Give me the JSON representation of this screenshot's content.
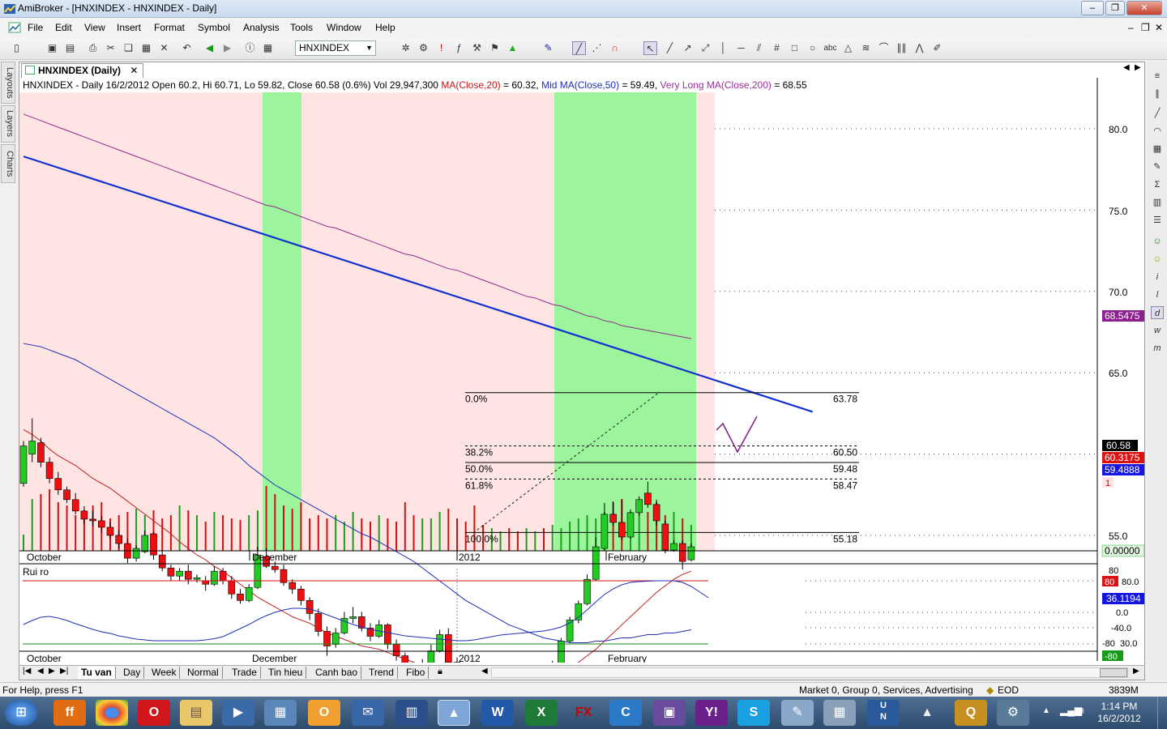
{
  "window": {
    "title": "AmiBroker - [HNXINDEX - HNXINDEX - Daily]",
    "doc_minimize": "–",
    "doc_restore": "❐",
    "doc_close": "✕"
  },
  "menu": [
    "File",
    "Edit",
    "View",
    "Insert",
    "Format",
    "Symbol",
    "Analysis",
    "Tools",
    "Window",
    "Help"
  ],
  "toolbar": {
    "symbol": "HNXINDEX"
  },
  "side_tabs": [
    "Layouts",
    "Layers",
    "Charts"
  ],
  "doc_tab": {
    "label": "HNXINDEX (Daily)",
    "close": "✕"
  },
  "header": {
    "prefix": "HNXINDEX - Daily 16/2/2012 Open 60.2, Hi 60.71, Lo 59.82, Close 60.58 (0.6%) Vol 29,947,300",
    "ma20_label": "MA(Close,20)",
    "ma20_value": " = 60.32,",
    "ma50_label": "Mid MA(Close,50)",
    "ma50_value": " = 59.49,",
    "ma200_label": "Very Long MA(Close,200)",
    "ma200_value": " = 68.55"
  },
  "axis": {
    "price_ticks": [
      "80.0",
      "75.0",
      "70.0",
      "65.0",
      "55.0"
    ],
    "price_tags": {
      "ma200": "68.5475",
      "close": "60.58",
      "ma20": "60.3175",
      "ma50": "59.4888",
      "one": "1",
      "zero": "0.00000"
    },
    "date_labels": [
      "October",
      "December",
      "2012",
      "February"
    ]
  },
  "fibo": {
    "levels": [
      {
        "pct": "0.0%",
        "value": "63.78"
      },
      {
        "pct": "38.2%",
        "value": "60.50"
      },
      {
        "pct": "50.0%",
        "value": "59.48"
      },
      {
        "pct": "61.8%",
        "value": "58.47"
      },
      {
        "pct": "100.0%",
        "value": "55.18"
      }
    ]
  },
  "indicator": {
    "name": "Rui ro",
    "tags": {
      "top": "80",
      "red": "80",
      "blue": "36.1194",
      "green": "-80"
    },
    "ticks": [
      "80.0",
      "0.0",
      "-40.0",
      "30.0"
    ],
    "ticks2": [
      "-80"
    ],
    "date_labels": [
      "October",
      "December",
      "2012",
      "February"
    ]
  },
  "sheet_tabs": [
    "Tu van",
    "Day",
    "Week",
    "Normal",
    "Trade",
    "Tin hieu",
    "Canh bao",
    "Trend",
    "Fibo"
  ],
  "status": {
    "help": "For Help, press F1",
    "market": "Market 0, Group 0, Services, Advertising",
    "mode": "EOD",
    "memory": "3839M"
  },
  "taskbar": {
    "time": "1:14 PM",
    "date": "16/2/2012"
  },
  "chart_data": {
    "type": "candlestick",
    "period": "Daily",
    "symbol": "HNXINDEX",
    "ylim": [
      54,
      83
    ],
    "candles": [
      {
        "o": 58.2,
        "c": 60.5,
        "h": 60.8,
        "l": 58.0
      },
      {
        "o": 60.0,
        "c": 60.8,
        "h": 62.2,
        "l": 59.5
      },
      {
        "o": 60.7,
        "c": 59.5,
        "h": 61.0,
        "l": 59.2
      },
      {
        "o": 59.5,
        "c": 58.5,
        "h": 59.8,
        "l": 58.2
      },
      {
        "o": 58.5,
        "c": 57.8,
        "h": 58.9,
        "l": 57.5
      },
      {
        "o": 57.8,
        "c": 57.2,
        "h": 58.0,
        "l": 57.0
      },
      {
        "o": 57.2,
        "c": 56.5,
        "h": 57.6,
        "l": 56.3
      },
      {
        "o": 56.5,
        "c": 56.0,
        "h": 56.8,
        "l": 55.7
      },
      {
        "o": 56.0,
        "c": 55.9,
        "h": 56.5,
        "l": 55.6
      },
      {
        "o": 55.9,
        "c": 55.5,
        "h": 56.2,
        "l": 55.2
      },
      {
        "o": 55.5,
        "c": 55.0,
        "h": 55.8,
        "l": 54.8
      },
      {
        "o": 55.0,
        "c": 54.5,
        "h": 55.3,
        "l": 54.2
      },
      {
        "o": 54.5,
        "c": 53.6,
        "h": 54.8,
        "l": 53.3
      },
      {
        "o": 53.6,
        "c": 54.2,
        "h": 54.4,
        "l": 53.4
      },
      {
        "o": 54.0,
        "c": 55.0,
        "h": 55.3,
        "l": 53.9
      },
      {
        "o": 55.1,
        "c": 53.8,
        "h": 55.2,
        "l": 53.5
      },
      {
        "o": 53.8,
        "c": 53.0,
        "h": 54.1,
        "l": 52.8
      },
      {
        "o": 53.0,
        "c": 52.5,
        "h": 53.2,
        "l": 52.2
      },
      {
        "o": 52.5,
        "c": 52.8,
        "h": 53.0,
        "l": 52.2
      },
      {
        "o": 52.8,
        "c": 52.3,
        "h": 53.2,
        "l": 52.0
      },
      {
        "o": 52.3,
        "c": 52.4,
        "h": 52.6,
        "l": 52.1
      },
      {
        "o": 52.2,
        "c": 52.0,
        "h": 52.5,
        "l": 51.6
      },
      {
        "o": 52.0,
        "c": 52.8,
        "h": 53.1,
        "l": 51.9
      },
      {
        "o": 52.8,
        "c": 52.2,
        "h": 53.0,
        "l": 52.0
      },
      {
        "o": 52.2,
        "c": 51.4,
        "h": 52.5,
        "l": 51.1
      },
      {
        "o": 51.4,
        "c": 51.0,
        "h": 51.7,
        "l": 50.8
      },
      {
        "o": 51.0,
        "c": 51.8,
        "h": 52.0,
        "l": 50.9
      },
      {
        "o": 51.8,
        "c": 53.8,
        "h": 54.3,
        "l": 51.7
      },
      {
        "o": 53.7,
        "c": 53.1,
        "h": 54.2,
        "l": 53.0
      },
      {
        "o": 53.1,
        "c": 52.9,
        "h": 53.4,
        "l": 52.7
      },
      {
        "o": 52.9,
        "c": 52.1,
        "h": 53.2,
        "l": 51.9
      },
      {
        "o": 52.1,
        "c": 51.7,
        "h": 52.3,
        "l": 51.4
      },
      {
        "o": 51.7,
        "c": 51.0,
        "h": 51.9,
        "l": 50.7
      },
      {
        "o": 51.0,
        "c": 50.2,
        "h": 51.2,
        "l": 49.8
      },
      {
        "o": 50.2,
        "c": 49.1,
        "h": 50.5,
        "l": 48.8
      },
      {
        "o": 49.1,
        "c": 48.2,
        "h": 49.4,
        "l": 47.6
      },
      {
        "o": 48.3,
        "c": 49.0,
        "h": 49.3,
        "l": 48.1
      },
      {
        "o": 49.0,
        "c": 49.9,
        "h": 50.3,
        "l": 48.9
      },
      {
        "o": 49.9,
        "c": 50.0,
        "h": 50.6,
        "l": 49.6
      },
      {
        "o": 50.0,
        "c": 49.3,
        "h": 50.3,
        "l": 49.1
      },
      {
        "o": 49.3,
        "c": 48.8,
        "h": 49.6,
        "l": 48.5
      },
      {
        "o": 48.8,
        "c": 49.5,
        "h": 49.8,
        "l": 48.7
      },
      {
        "o": 49.5,
        "c": 48.3,
        "h": 49.6,
        "l": 48.0
      },
      {
        "o": 48.3,
        "c": 47.6,
        "h": 48.6,
        "l": 47.3
      },
      {
        "o": 47.6,
        "c": 46.9,
        "h": 47.8,
        "l": 46.5
      },
      {
        "o": 46.9,
        "c": 46.3,
        "h": 47.2,
        "l": 45.9
      },
      {
        "o": 46.3,
        "c": 47.1,
        "h": 47.4,
        "l": 46.2
      },
      {
        "o": 47.1,
        "c": 47.9,
        "h": 48.3,
        "l": 47.0
      },
      {
        "o": 47.9,
        "c": 48.9,
        "h": 49.2,
        "l": 47.8
      },
      {
        "o": 48.9,
        "c": 47.2,
        "h": 49.3,
        "l": 47.0
      },
      {
        "o": 47.2,
        "c": 46.5,
        "h": 47.5,
        "l": 46.3
      },
      {
        "o": 46.3,
        "c": 45.9,
        "h": 46.6,
        "l": 45.6
      },
      {
        "o": 45.6,
        "c": 45.3,
        "h": 45.9,
        "l": 45.1
      },
      {
        "o": 45.3,
        "c": 45.0,
        "h": 45.6,
        "l": 44.9
      },
      {
        "o": 44.9,
        "c": 45.3,
        "h": 45.4,
        "l": 44.9
      },
      {
        "o": 45.2,
        "c": 46.1,
        "h": 46.3,
        "l": 45.1
      },
      {
        "o": 46.1,
        "c": 45.8,
        "h": 46.4,
        "l": 45.7
      },
      {
        "o": 45.8,
        "c": 45.6,
        "h": 46.1,
        "l": 45.4
      },
      {
        "o": 45.6,
        "c": 46.0,
        "h": 46.2,
        "l": 45.5
      },
      {
        "o": 46.0,
        "c": 46.7,
        "h": 46.9,
        "l": 45.9
      },
      {
        "o": 46.7,
        "c": 46.3,
        "h": 46.9,
        "l": 46.1
      },
      {
        "o": 46.3,
        "c": 47.1,
        "h": 47.3,
        "l": 46.2
      },
      {
        "o": 47.1,
        "c": 48.5,
        "h": 48.7,
        "l": 47.0
      },
      {
        "o": 48.5,
        "c": 49.8,
        "h": 50.0,
        "l": 48.4
      },
      {
        "o": 49.8,
        "c": 50.8,
        "h": 51.0,
        "l": 49.6
      },
      {
        "o": 50.8,
        "c": 52.3,
        "h": 52.6,
        "l": 50.7
      },
      {
        "o": 52.3,
        "c": 54.3,
        "h": 54.9,
        "l": 52.2
      },
      {
        "o": 54.2,
        "c": 56.3,
        "h": 57.0,
        "l": 54.1
      },
      {
        "o": 56.3,
        "c": 55.8,
        "h": 57.1,
        "l": 55.6
      },
      {
        "o": 55.8,
        "c": 54.9,
        "h": 57.2,
        "l": 54.7
      },
      {
        "o": 54.9,
        "c": 56.4,
        "h": 56.6,
        "l": 54.8
      },
      {
        "o": 56.4,
        "c": 57.2,
        "h": 57.4,
        "l": 56.2
      },
      {
        "o": 57.6,
        "c": 56.9,
        "h": 58.3,
        "l": 56.7
      },
      {
        "o": 56.9,
        "c": 55.9,
        "h": 57.2,
        "l": 55.6
      },
      {
        "o": 55.7,
        "c": 54.1,
        "h": 55.9,
        "l": 53.9
      },
      {
        "o": 54.1,
        "c": 54.5,
        "h": 54.7,
        "l": 54.0
      },
      {
        "o": 54.5,
        "c": 53.4,
        "h": 54.7,
        "l": 52.9
      },
      {
        "o": 53.5,
        "c": 54.3,
        "h": 54.5,
        "l": 53.4
      }
    ],
    "ma20": [
      61.5,
      61.2,
      60.8,
      60.3,
      59.9,
      59.6,
      59.3,
      58.9,
      58.5,
      58.2,
      57.9,
      57.5,
      57.1,
      56.7,
      56.3,
      55.9,
      55.5,
      55.1,
      54.6,
      54.2,
      53.8,
      53.5,
      53.1,
      52.8,
      52.4,
      52.0,
      51.6,
      51.2,
      50.9,
      50.6,
      50.3,
      50.0,
      49.8,
      49.6,
      49.3,
      49.0,
      48.8,
      48.6,
      48.4,
      48.2,
      48.1,
      48.0,
      47.8,
      47.6,
      47.4,
      47.2,
      47.0,
      46.9,
      46.8,
      46.7,
      46.6,
      46.5,
      46.4,
      46.3,
      46.3,
      46.2,
      46.2,
      46.1,
      46.1,
      46.2,
      46.3,
      46.4,
      46.6,
      46.9,
      47.2,
      47.6,
      48.0,
      48.5,
      49.0,
      49.5,
      50.0,
      50.5,
      51.0,
      51.5,
      51.9,
      52.3,
      52.6,
      52.8
    ],
    "ma50": [
      66.8,
      66.7,
      66.6,
      66.4,
      66.2,
      66.0,
      65.8,
      65.5,
      65.2,
      64.9,
      64.6,
      64.3,
      64.0,
      63.7,
      63.4,
      63.1,
      62.8,
      62.5,
      62.2,
      61.9,
      61.6,
      61.3,
      61.0,
      60.6,
      60.2,
      59.8,
      59.3,
      58.9,
      58.5,
      58.1,
      57.8,
      57.5,
      57.2,
      56.9,
      56.6,
      56.3,
      56.0,
      55.7,
      55.4,
      55.1,
      54.9,
      54.6,
      54.3,
      54.0,
      53.7,
      53.4,
      53.0,
      52.6,
      52.2,
      51.8,
      51.4,
      51.0,
      50.7,
      50.4,
      50.1,
      49.8,
      49.5,
      49.3,
      49.1,
      48.9,
      48.7,
      48.6,
      48.5,
      48.4,
      48.4,
      48.4,
      48.5,
      48.5,
      48.6,
      48.7,
      48.7,
      48.8,
      48.9,
      48.9,
      49.0,
      49.0,
      49.1,
      49.2
    ],
    "ma200": [
      80.9,
      80.7,
      80.5,
      80.3,
      80.1,
      79.9,
      79.7,
      79.5,
      79.3,
      79.1,
      78.9,
      78.7,
      78.5,
      78.3,
      78.1,
      77.9,
      77.7,
      77.5,
      77.3,
      77.1,
      76.9,
      76.7,
      76.5,
      76.3,
      76.1,
      75.9,
      75.7,
      75.5,
      75.3,
      75.2,
      75.0,
      74.8,
      74.6,
      74.4,
      74.2,
      74.0,
      73.9,
      73.7,
      73.5,
      73.3,
      73.1,
      72.9,
      72.7,
      72.5,
      72.3,
      72.2,
      72.0,
      71.8,
      71.6,
      71.4,
      71.3,
      71.1,
      70.9,
      70.7,
      70.5,
      70.3,
      70.1,
      69.9,
      69.7,
      69.6,
      69.4,
      69.2,
      69.1,
      68.9,
      68.7,
      68.5,
      68.4,
      68.2,
      68.1,
      67.9,
      67.8,
      67.7,
      67.6,
      67.5,
      67.4,
      67.3,
      67.2,
      67.1
    ],
    "volume": [
      0.1,
      0.32,
      0.35,
      0.38,
      0.3,
      0.28,
      0.22,
      0.25,
      0.28,
      0.3,
      0.2,
      0.22,
      0.24,
      0.26,
      0.22,
      0.25,
      0.2,
      0.22,
      0.28,
      0.25,
      0.22,
      0.18,
      0.24,
      0.22,
      0.2,
      0.19,
      0.22,
      0.25,
      0.4,
      0.35,
      0.28,
      0.26,
      0.3,
      0.2,
      0.22,
      0.2,
      0.22,
      0.18,
      0.24,
      0.2,
      0.18,
      0.22,
      0.2,
      0.18,
      0.3,
      0.22,
      0.2,
      0.2,
      0.24,
      0.26,
      0.2,
      0.18,
      0.28,
      0.16,
      0.14,
      0.12,
      0.14,
      0.12,
      0.14,
      0.12,
      0.14,
      0.16,
      0.14,
      0.18,
      0.2,
      0.22,
      0.2,
      0.24,
      0.3,
      0.32,
      0.24,
      0.3,
      0.24,
      0.3,
      0.22,
      0.24,
      0.2,
      0.16
    ],
    "trendline": {
      "from": [
        0,
        78.3
      ],
      "to": [
        91,
        62.6
      ]
    },
    "fibo_retracement": {
      "high": 63.78,
      "low": 55.18
    },
    "indicator_series": [
      -30,
      -20,
      -12,
      -10,
      -14,
      -20,
      -28,
      -35,
      -42,
      -48,
      -52,
      -58,
      -62,
      -66,
      -68,
      -70,
      -70,
      -70,
      -70,
      -70,
      -70,
      -68,
      -65,
      -60,
      -50,
      -40,
      -30,
      -18,
      -8,
      0,
      6,
      10,
      10,
      8,
      2,
      -6,
      -14,
      -22,
      -30,
      -36,
      -42,
      -46,
      -50,
      -54,
      -58,
      -60,
      -62,
      -64,
      -66,
      -68,
      -70,
      -70,
      -68,
      -64,
      -60,
      -56,
      -54,
      -52,
      -50,
      -48,
      -46,
      -42,
      -36,
      -26,
      -12,
      6,
      26,
      44,
      58,
      68,
      74,
      76,
      77,
      78,
      78,
      78,
      74,
      64,
      50,
      36
    ]
  }
}
